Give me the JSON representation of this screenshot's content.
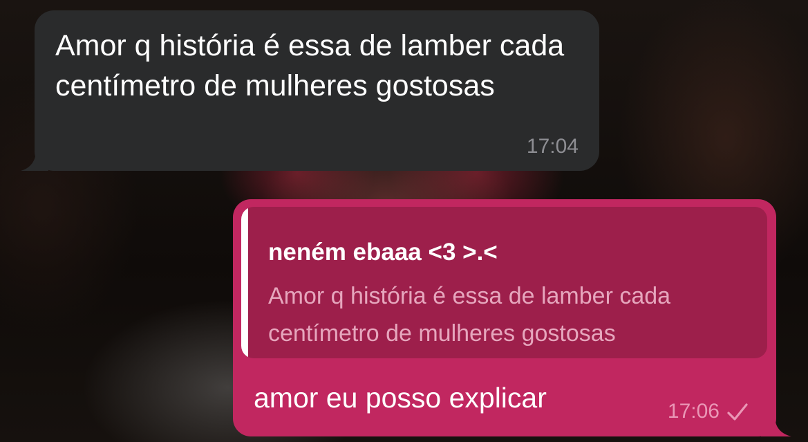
{
  "conversation": {
    "incoming": {
      "text": "Amor q história é essa de lamber cada centímetro de mulheres gostosas",
      "time": "17:04",
      "bubble_color": "#2a2b2c"
    },
    "outgoing": {
      "reply": {
        "author": "neném ebaaa <3 >.<",
        "snippet": "Amor q história é essa de lamber cada centímetro de mulheres gostosas"
      },
      "text": "amor eu posso explicar",
      "time": "17:06",
      "status_icon": "check-icon",
      "bubble_color": "#c12760"
    }
  }
}
